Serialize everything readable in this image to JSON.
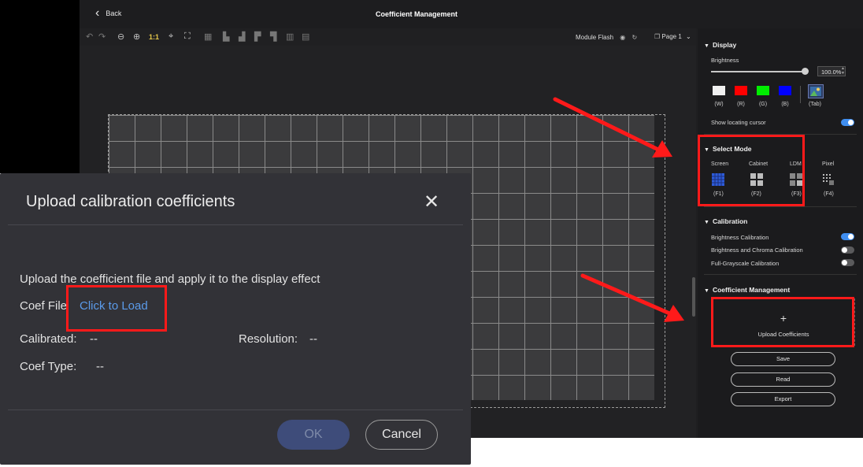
{
  "header": {
    "back_label": "Back",
    "title": "Coefficient Management"
  },
  "toolbar": {
    "zoom_1to1": "1:1",
    "module_flash": "Module Flash",
    "page": "Page 1"
  },
  "display": {
    "section_title": "Display",
    "brightness_label": "Brightness",
    "brightness_value": "100.0%",
    "brightness_fraction": 1.0,
    "colors": [
      {
        "label": "(W)",
        "color": "#f0f0f0"
      },
      {
        "label": "(R)",
        "color": "#ff0000"
      },
      {
        "label": "(G)",
        "color": "#00ee00"
      },
      {
        "label": "(B)",
        "color": "#0000ff"
      }
    ],
    "tab_label": "(Tab)",
    "cursor_label": "Show locating cursor",
    "cursor_on": true
  },
  "select_mode": {
    "section_title": "Select Mode",
    "modes": [
      {
        "label": "Screen",
        "key": "(F1)"
      },
      {
        "label": "Cabinet",
        "key": "(F2)"
      },
      {
        "label": "LDM",
        "key": "(F3)"
      },
      {
        "label": "Pixel",
        "key": "(F4)"
      }
    ]
  },
  "calibration": {
    "section_title": "Calibration",
    "items": [
      {
        "label": "Brightness Calibration",
        "on": true
      },
      {
        "label": "Brightness and Chroma Calibration",
        "on": false
      },
      {
        "label": "Full-Grayscale Calibration",
        "on": false
      }
    ]
  },
  "coefficient": {
    "section_title": "Coefficient Management",
    "upload_label": "Upload Coefficients",
    "upload_plus": "+",
    "save_label": "Save",
    "read_label": "Read",
    "export_label": "Export"
  },
  "dialog": {
    "title": "Upload calibration coefficients",
    "close": "✕",
    "description": "Upload the coefficient file and apply it to the display effect",
    "coef_file_label": "Coef File",
    "click_to_load": "Click to Load",
    "calibrated_label": "Calibrated:",
    "calibrated_value": "--",
    "resolution_label": "Resolution:",
    "resolution_value": "--",
    "coef_type_label": "Coef Type:",
    "coef_type_value": "--",
    "ok_label": "OK",
    "cancel_label": "Cancel"
  },
  "colors": {
    "accent": "#3f8ef0",
    "highlight": "#ff1a1a",
    "link": "#5b9bea"
  }
}
